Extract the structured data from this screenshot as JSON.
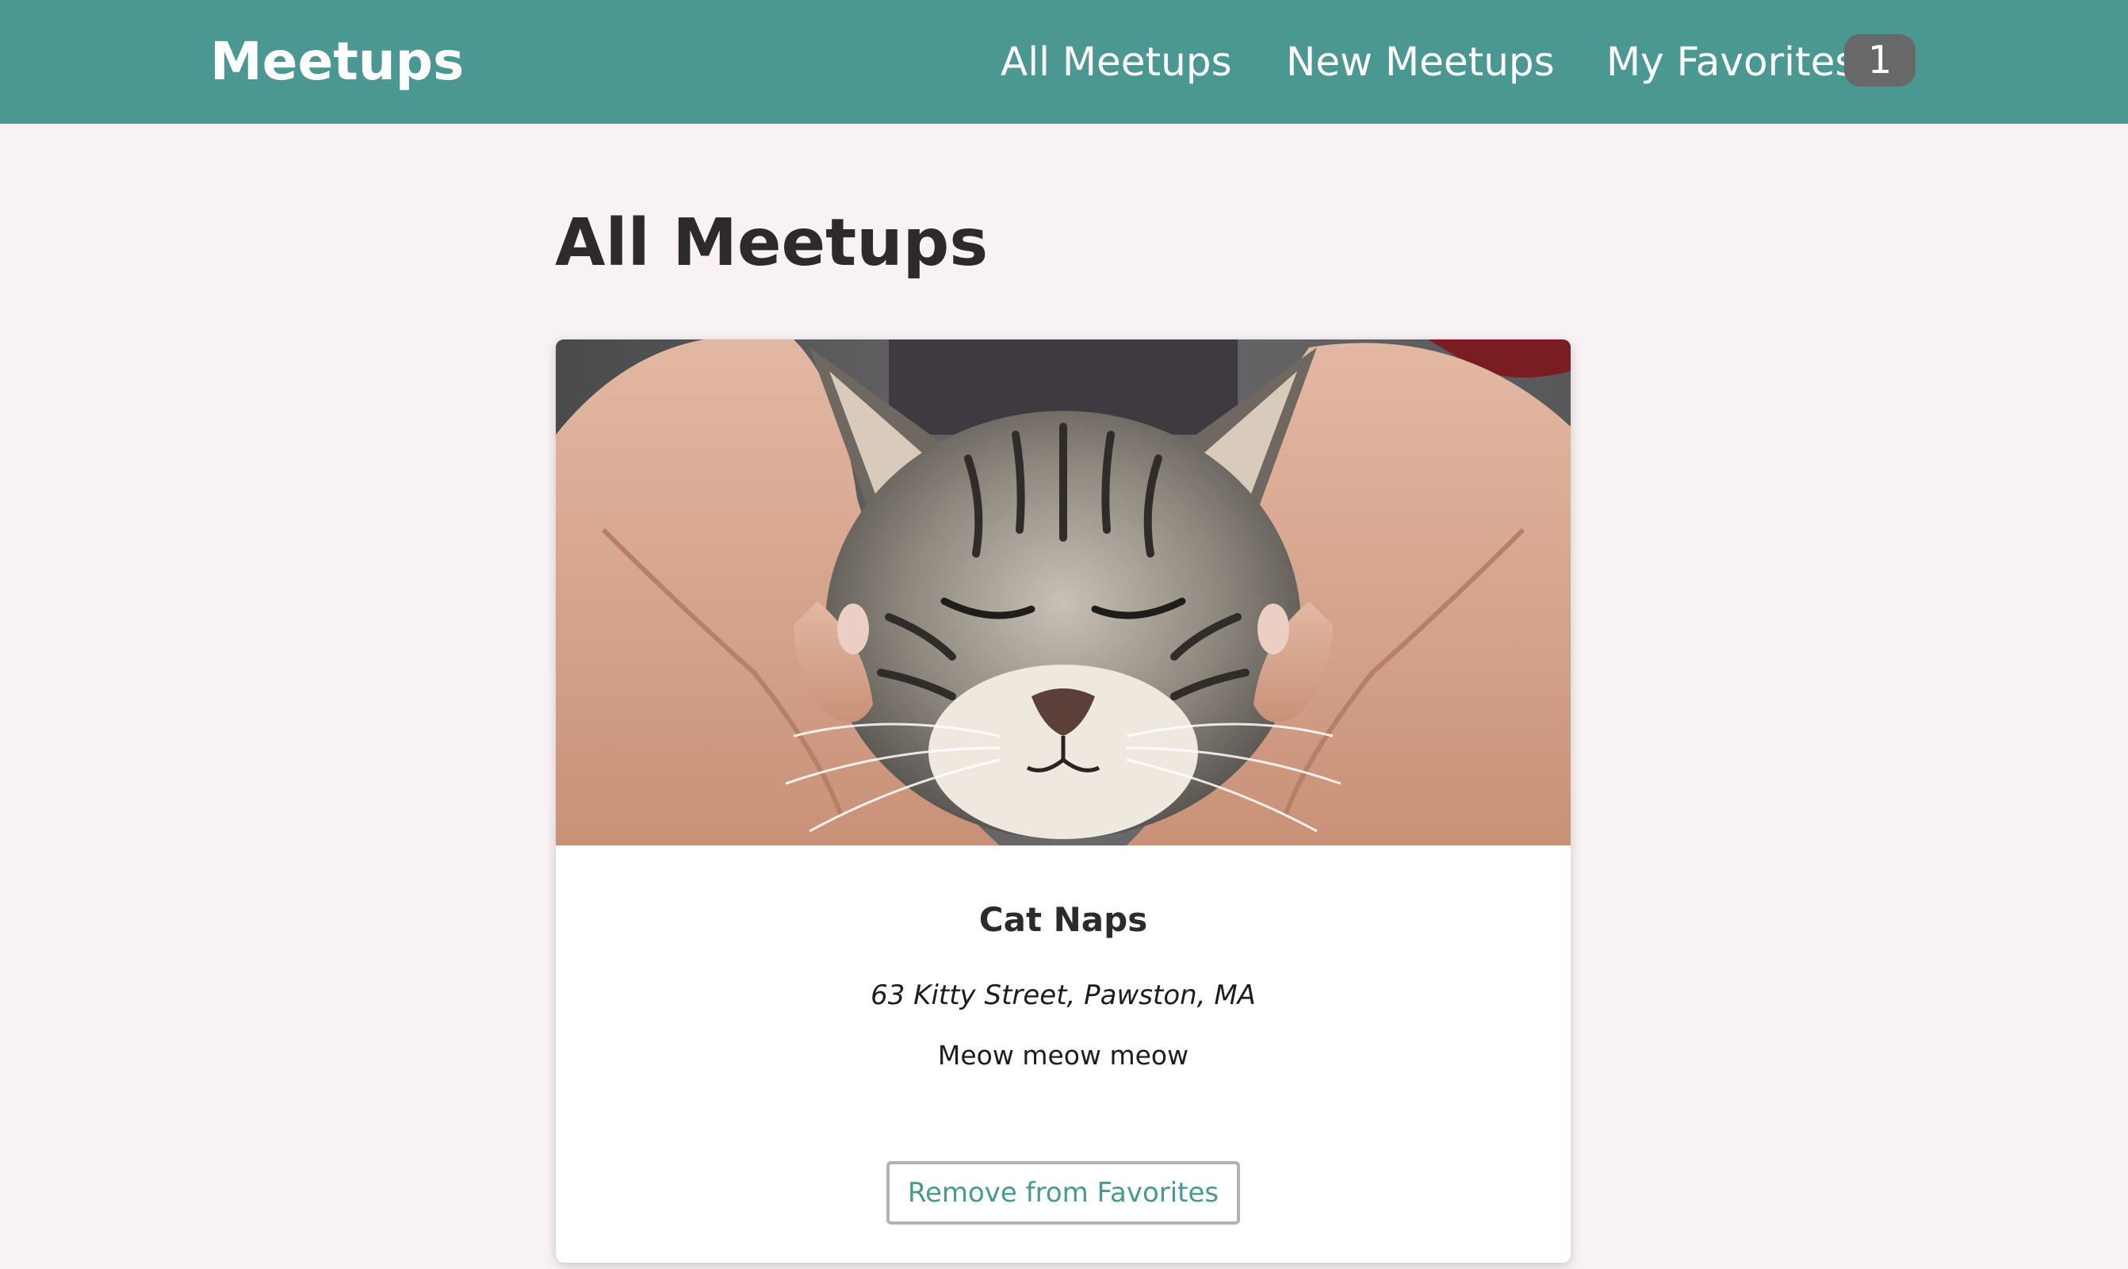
{
  "header": {
    "logo": "Meetups",
    "nav": {
      "all_meetups": "All Meetups",
      "new_meetups": "New Meetups",
      "my_favorites": "My Favorites",
      "favorites_count": "1"
    },
    "colors": {
      "bar": "#4b9892",
      "badge": "#686868"
    }
  },
  "main": {
    "title": "All Meetups",
    "meetups": [
      {
        "title": "Cat Naps",
        "address": "63 Kitty Street, Pawston, MA",
        "description": "Meow meow meow",
        "button_label": "Remove from Favorites",
        "image_icon": "cat-photo"
      }
    ]
  }
}
